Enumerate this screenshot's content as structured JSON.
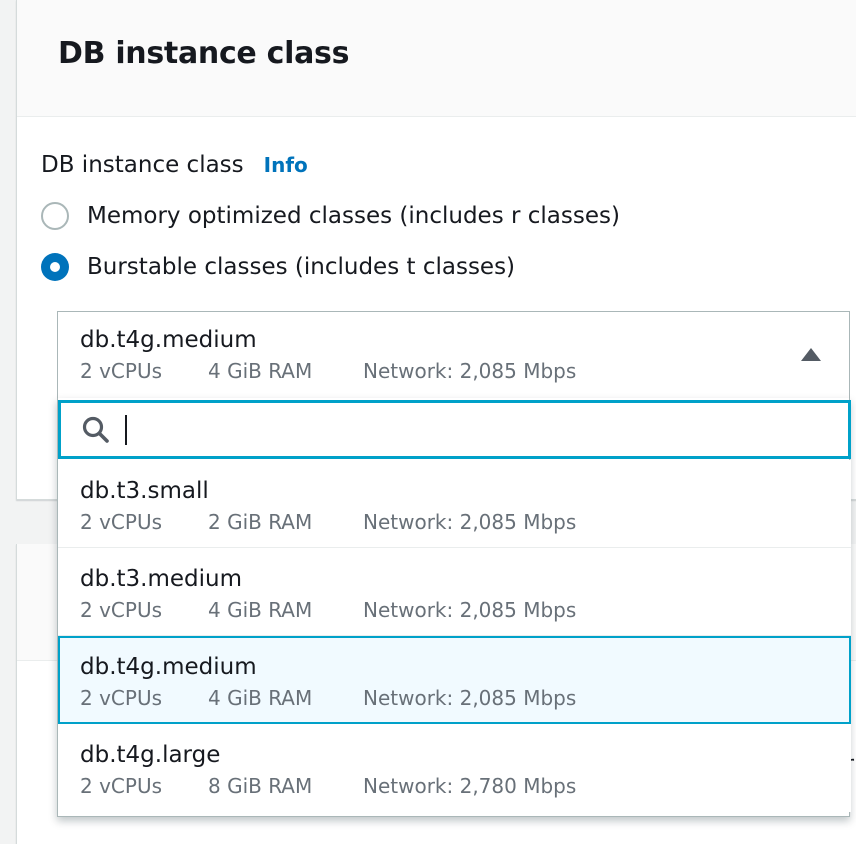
{
  "panel": {
    "title": "DB instance class"
  },
  "field": {
    "label": "DB instance class",
    "info_link": "Info"
  },
  "radios": [
    {
      "label": "Memory optimized classes (includes r classes)",
      "checked": false
    },
    {
      "label": "Burstable classes (includes t classes)",
      "checked": true
    }
  ],
  "select": {
    "selected": {
      "name": "db.t4g.medium",
      "vcpus": "2 vCPUs",
      "ram": "4 GiB RAM",
      "network": "Network: 2,085 Mbps"
    },
    "search": {
      "value": "",
      "icon": "search-icon"
    },
    "options": [
      {
        "name": "db.t3.small",
        "vcpus": "2 vCPUs",
        "ram": "2 GiB RAM",
        "network": "Network: 2,085 Mbps",
        "selected": false
      },
      {
        "name": "db.t3.medium",
        "vcpus": "2 vCPUs",
        "ram": "4 GiB RAM",
        "network": "Network: 2,085 Mbps",
        "selected": false
      },
      {
        "name": "db.t4g.medium",
        "vcpus": "2 vCPUs",
        "ram": "4 GiB RAM",
        "network": "Network: 2,085 Mbps",
        "selected": true
      },
      {
        "name": "db.t4g.large",
        "vcpus": "2 vCPUs",
        "ram": "8 GiB RAM",
        "network": "Network: 2,780 Mbps",
        "selected": false
      }
    ]
  },
  "colors": {
    "accent": "#0073bb",
    "focus": "#00a1c9",
    "selected_bg": "#f1faff",
    "secondary_text": "#687078"
  },
  "edge_glyph": "r"
}
